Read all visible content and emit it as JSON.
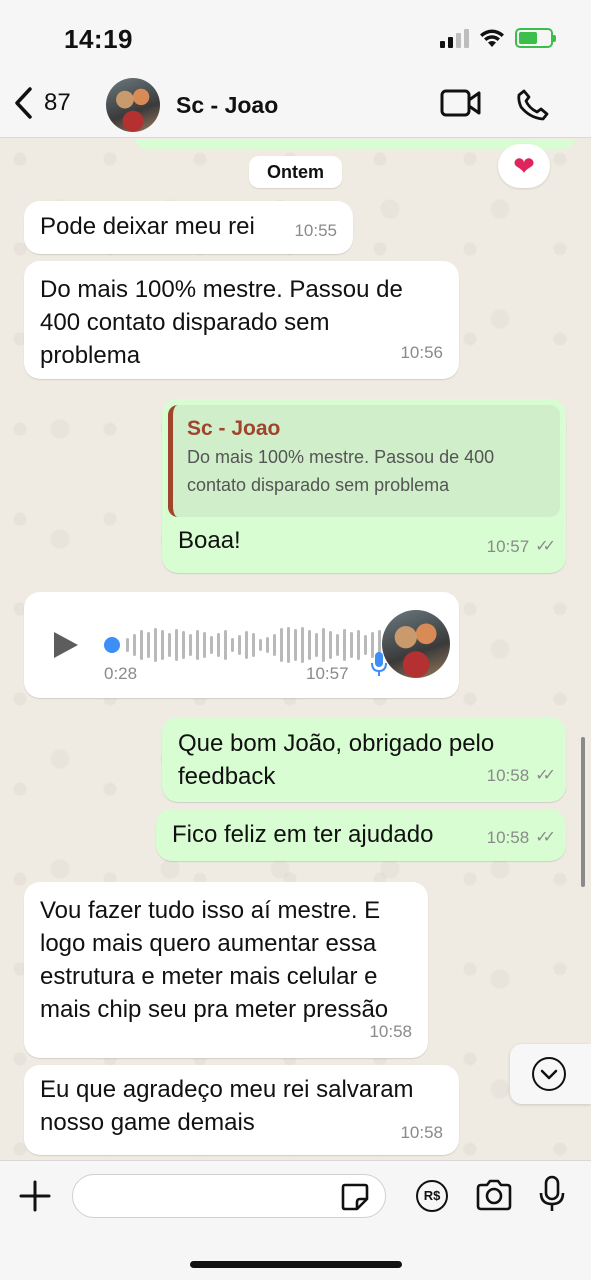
{
  "status": {
    "time": "14:19"
  },
  "header": {
    "back_count": "87",
    "contact_name": "Sc - Joao"
  },
  "chat": {
    "date_divider": "Ontem",
    "reaction": "❤",
    "messages": [
      {
        "dir": "in",
        "text": "Pode deixar meu rei",
        "time": "10:55"
      },
      {
        "dir": "in",
        "text": "Do mais 100% mestre. Passou de\n400 contato disparado sem\nproblema",
        "time": "10:56"
      },
      {
        "dir": "out",
        "quote_author": "Sc - Joao",
        "quote_text": "Do mais 100% mestre. Passou de 400\ncontato disparado sem problema",
        "text": "Boaa!",
        "time": "10:57",
        "ticks": "✓✓"
      },
      {
        "dir": "in",
        "type": "voice",
        "duration": "0:28",
        "time": "10:57"
      },
      {
        "dir": "out",
        "text": "Que bom João, obrigado pelo\nfeedback",
        "time": "10:58",
        "ticks": "✓✓"
      },
      {
        "dir": "out",
        "text": "Fico feliz em ter ajudado",
        "time": "10:58",
        "ticks": "✓✓"
      },
      {
        "dir": "in",
        "text": "Vou fazer tudo isso aí mestre. E\nlogo mais quero aumentar essa\nestrutura e meter mais celular e\nmais chip seu pra meter pressão",
        "time": "10:58"
      },
      {
        "dir": "in",
        "text": "Eu que agradeço meu rei salvaram\nnosso game demais",
        "time": "10:58"
      }
    ]
  },
  "input": {
    "value": "",
    "placeholder": "",
    "pix_label": "R$"
  },
  "colors": {
    "outgoing": "#d9fdd3",
    "incoming": "#ffffff",
    "quote_accent": "#a0442c",
    "voice_dot": "#3e8ef7"
  }
}
